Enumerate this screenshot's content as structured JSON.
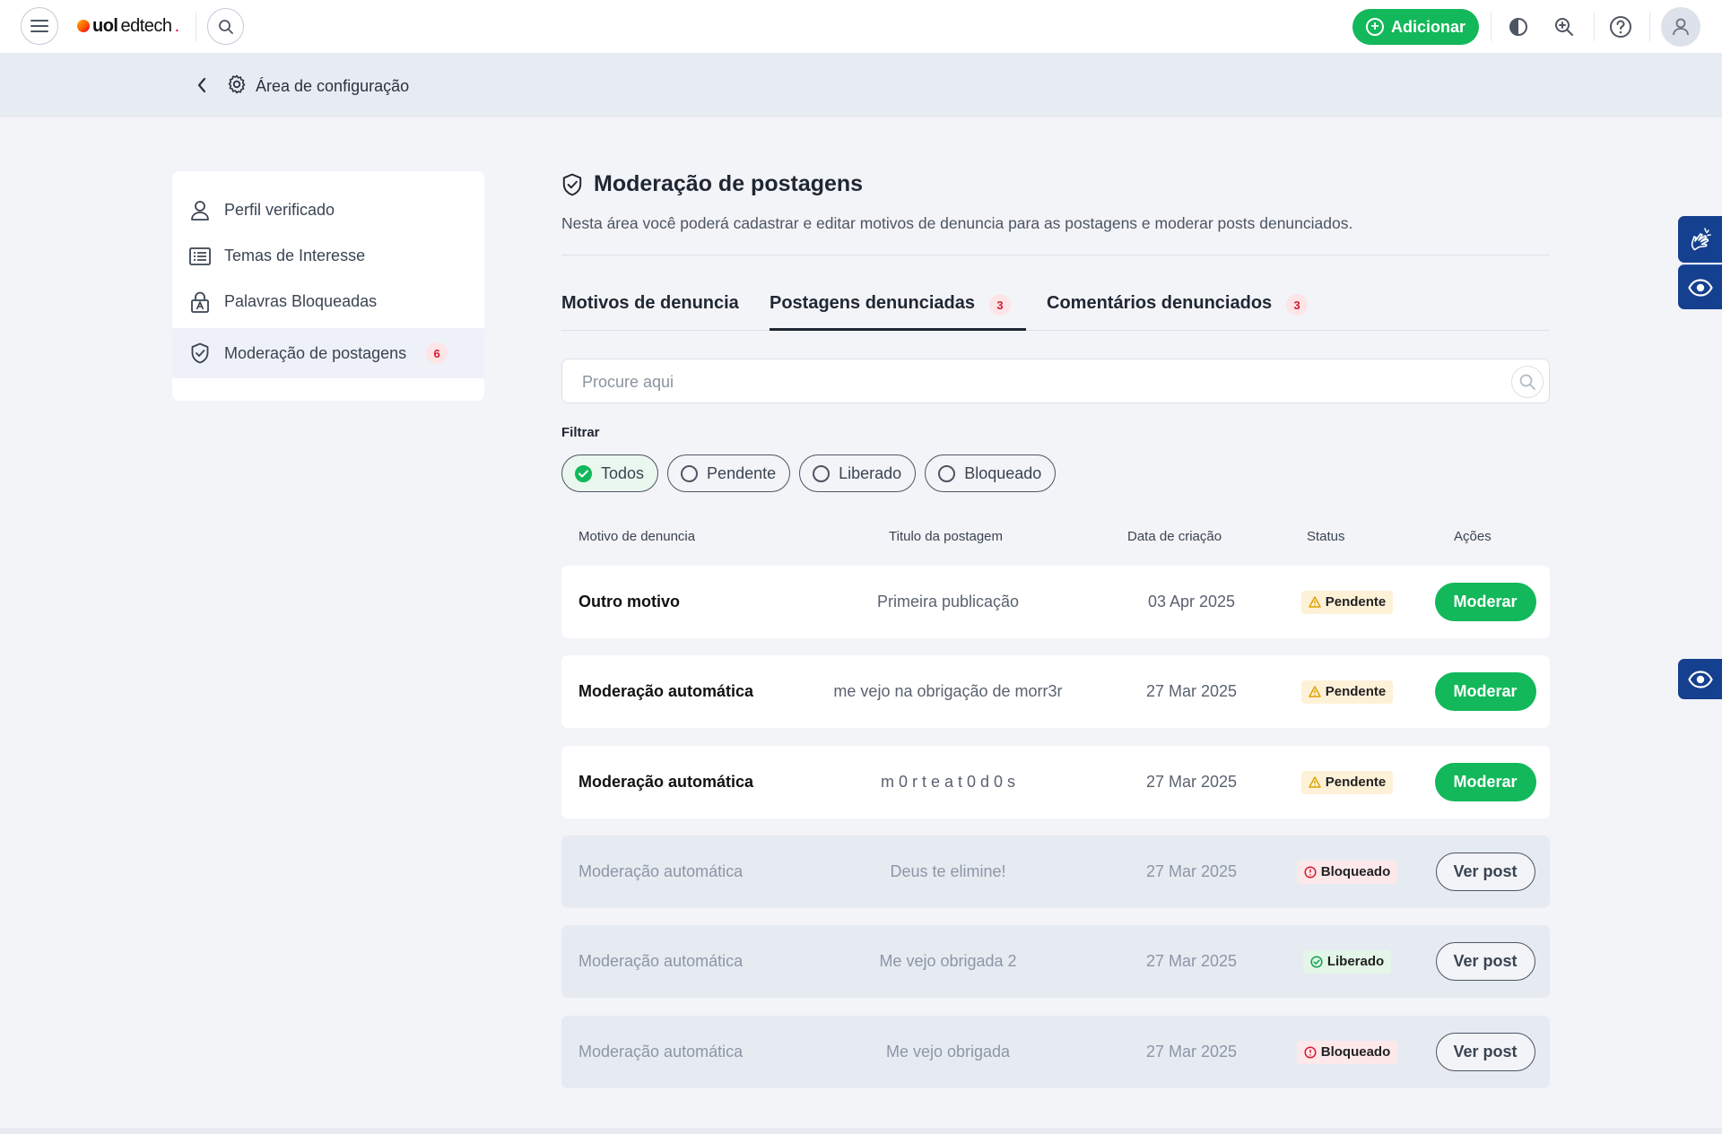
{
  "topbar": {
    "logo_uol": "uol",
    "logo_ed": "edtech",
    "logo_period": ".",
    "add_label": "Adicionar",
    "colors": {
      "accent_green": "#12b85a",
      "badge_red": "#d8182f",
      "acc_blue": "#15408f"
    }
  },
  "breadcrumb": {
    "title": "Área de configuração"
  },
  "sidebar": {
    "items": [
      {
        "label": "Perfil verificado",
        "icon": "user-icon"
      },
      {
        "label": "Temas de Interesse",
        "icon": "list-icon"
      },
      {
        "label": "Palavras Bloqueadas",
        "icon": "lock-icon"
      },
      {
        "label": "Moderação de postagens",
        "icon": "shield-icon",
        "badge": "6",
        "active": true
      }
    ]
  },
  "main": {
    "title": "Moderação de postagens",
    "description": "Nesta área você poderá cadastrar e editar motivos de denuncia para as postagens e moderar posts denunciados.",
    "tabs": [
      {
        "label": "Motivos de denuncia"
      },
      {
        "label": "Postagens denunciadas",
        "badge": "3",
        "active": true
      },
      {
        "label": "Comentários denunciados",
        "badge": "3"
      }
    ],
    "search": {
      "placeholder": "Procure aqui",
      "value": ""
    },
    "filter_label": "Filtrar",
    "filters": [
      {
        "label": "Todos",
        "selected": true
      },
      {
        "label": "Pendente",
        "selected": false
      },
      {
        "label": "Liberado",
        "selected": false
      },
      {
        "label": "Bloqueado",
        "selected": false
      }
    ],
    "table": {
      "headers": [
        "Motivo de denuncia",
        "Titulo da postagem",
        "Data de criação",
        "Status",
        "Ações"
      ],
      "rows": [
        {
          "motivo": "Outro motivo",
          "titulo": "Primeira publicação",
          "data": "03 Apr 2025",
          "status": "Pendente",
          "action": "Moderar"
        },
        {
          "motivo": "Moderação automática",
          "titulo": "me vejo na obrigação de morr3r",
          "data": "27 Mar 2025",
          "status": "Pendente",
          "action": "Moderar"
        },
        {
          "motivo": "Moderação automática",
          "titulo": "m 0 r t e a t 0 d 0 s",
          "data": "27 Mar 2025",
          "status": "Pendente",
          "action": "Moderar"
        },
        {
          "motivo": "Moderação automática",
          "titulo": "Deus te elimine!",
          "data": "27 Mar 2025",
          "status": "Bloqueado",
          "action": "Ver post"
        },
        {
          "motivo": "Moderação automática",
          "titulo": "Me vejo obrigada 2",
          "data": "27 Mar 2025",
          "status": "Liberado",
          "action": "Ver post"
        },
        {
          "motivo": "Moderação automática",
          "titulo": "Me vejo obrigada",
          "data": "27 Mar 2025",
          "status": "Bloqueado",
          "action": "Ver post"
        }
      ]
    }
  }
}
